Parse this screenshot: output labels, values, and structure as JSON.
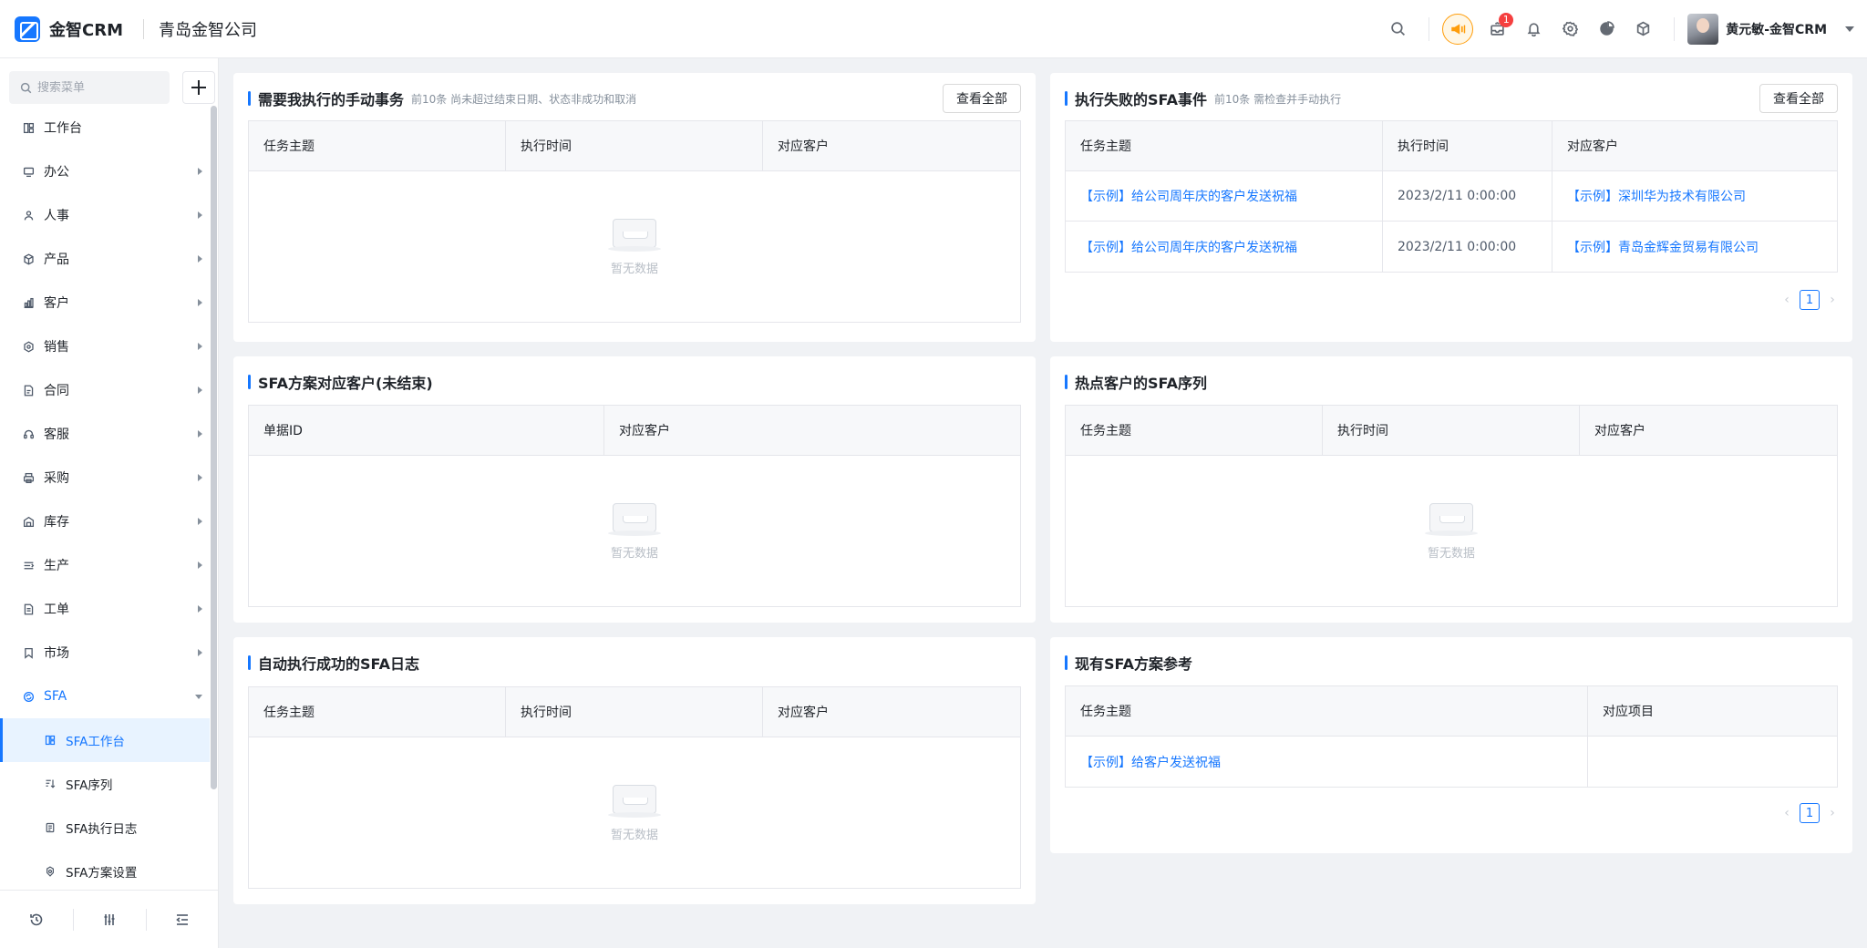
{
  "header": {
    "logo_text": "金智CRM",
    "company": "青岛金智公司",
    "notification_count": "1",
    "user_name": "黄元敏-金智CRM"
  },
  "sidebar": {
    "search_placeholder": "搜索菜单",
    "items": [
      {
        "label": "工作台",
        "icon": "dashboard-icon",
        "has_children": false
      },
      {
        "label": "办公",
        "icon": "monitor-icon",
        "has_children": true
      },
      {
        "label": "人事",
        "icon": "people-icon",
        "has_children": true
      },
      {
        "label": "产品",
        "icon": "box-icon",
        "has_children": true
      },
      {
        "label": "客户",
        "icon": "chart-icon",
        "has_children": true
      },
      {
        "label": "销售",
        "icon": "hexagon-icon",
        "has_children": true
      },
      {
        "label": "合同",
        "icon": "contract-icon",
        "has_children": true
      },
      {
        "label": "客服",
        "icon": "headset-icon",
        "has_children": true
      },
      {
        "label": "采购",
        "icon": "printer-icon",
        "has_children": true
      },
      {
        "label": "库存",
        "icon": "warehouse-icon",
        "has_children": true
      },
      {
        "label": "生产",
        "icon": "production-icon",
        "has_children": true
      },
      {
        "label": "工单",
        "icon": "ticket-icon",
        "has_children": true
      },
      {
        "label": "市场",
        "icon": "bookmark-icon",
        "has_children": true
      },
      {
        "label": "SFA",
        "icon": "sfa-icon",
        "has_children": true,
        "open": true
      }
    ],
    "sfa_children": [
      {
        "label": "SFA工作台",
        "icon": "dashboard-icon",
        "active": true
      },
      {
        "label": "SFA序列",
        "icon": "sort-icon",
        "active": false
      },
      {
        "label": "SFA执行日志",
        "icon": "log-icon",
        "active": false
      },
      {
        "label": "SFA方案设置",
        "icon": "settings-icon",
        "active": false
      }
    ]
  },
  "cards": {
    "manual_tasks": {
      "title": "需要我执行的手动事务",
      "subtitle": "前10条  尚未超过结束日期、状态非成功和取消",
      "view_all": "查看全部",
      "columns": [
        "任务主题",
        "执行时间",
        "对应客户"
      ],
      "empty_text": "暂无数据"
    },
    "failed_events": {
      "title": "执行失败的SFA事件",
      "subtitle": "前10条  需检查并手动执行",
      "view_all": "查看全部",
      "columns": [
        "任务主题",
        "执行时间",
        "对应客户"
      ],
      "rows": [
        [
          "【示例】给公司周年庆的客户发送祝福",
          "2023/2/11 0:00:00",
          "【示例】深圳华为技术有限公司"
        ],
        [
          "【示例】给公司周年庆的客户发送祝福",
          "2023/2/11 0:00:00",
          "【示例】青岛金辉金贸易有限公司"
        ]
      ],
      "page": "1"
    },
    "plan_customers": {
      "title": "SFA方案对应客户(未结束)",
      "columns": [
        "单据ID",
        "对应客户"
      ],
      "empty_text": "暂无数据"
    },
    "hot_customers": {
      "title": "热点客户的SFA序列",
      "columns": [
        "任务主题",
        "执行时间",
        "对应客户"
      ],
      "empty_text": "暂无数据"
    },
    "success_logs": {
      "title": "自动执行成功的SFA日志",
      "columns": [
        "任务主题",
        "执行时间",
        "对应客户"
      ],
      "empty_text": "暂无数据"
    },
    "plan_reference": {
      "title": "现有SFA方案参考",
      "columns": [
        "任务主题",
        "对应项目"
      ],
      "rows": [
        [
          "【示例】给客户发送祝福",
          ""
        ]
      ],
      "page": "1"
    }
  },
  "colors": {
    "accent": "#1677ff",
    "warning": "#ff9d0a",
    "badge": "#f53f3f"
  }
}
